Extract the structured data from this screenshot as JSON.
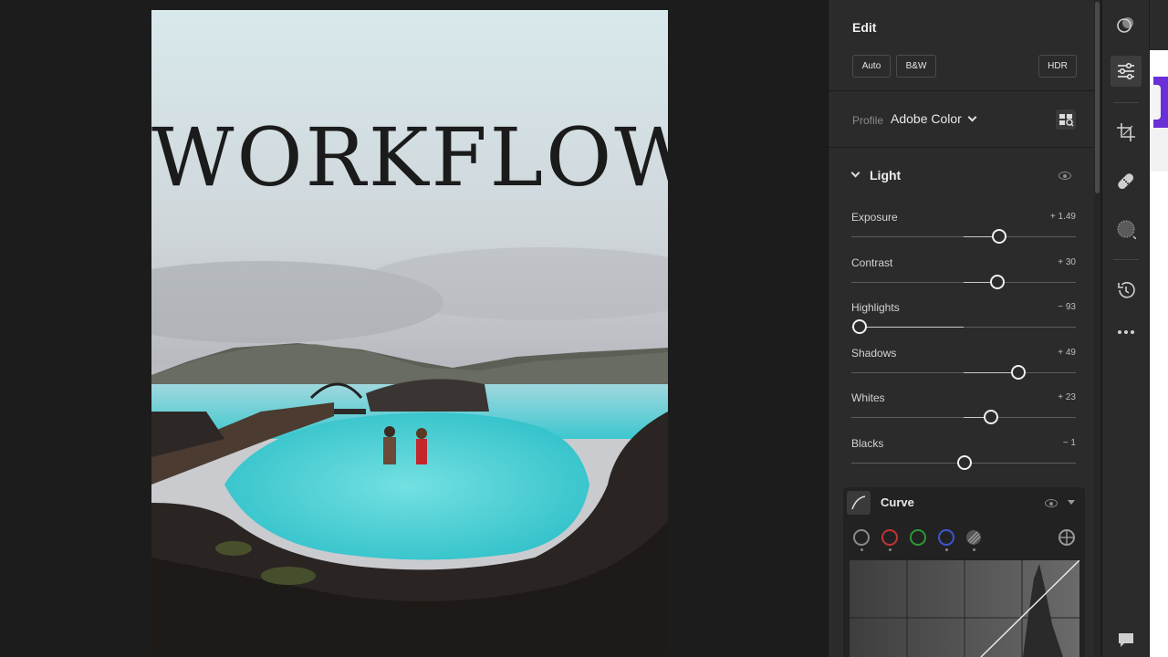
{
  "photo": {
    "overlay_text": "WORKFLOW"
  },
  "edit": {
    "title": "Edit",
    "buttons": {
      "auto": "Auto",
      "bw": "B&W",
      "hdr": "HDR"
    }
  },
  "profile": {
    "label": "Profile",
    "value": "Adobe Color",
    "browse_icon": "profile-browser-icon"
  },
  "light": {
    "title": "Light",
    "sliders": [
      {
        "label": "Exposure",
        "value": "+ 1.49",
        "pos": 0.66
      },
      {
        "label": "Contrast",
        "value": "+ 30",
        "pos": 0.65
      },
      {
        "label": "Highlights",
        "value": "− 93",
        "pos": 0.035
      },
      {
        "label": "Shadows",
        "value": "+ 49",
        "pos": 0.745
      },
      {
        "label": "Whites",
        "value": "+ 23",
        "pos": 0.62
      },
      {
        "label": "Blacks",
        "value": "− 1",
        "pos": 0.505
      }
    ]
  },
  "curve": {
    "title": "Curve",
    "channels": [
      "point-curve",
      "red",
      "green",
      "blue",
      "parametric"
    ],
    "channel_colors": [
      "#8a8a8a",
      "#d23b3b",
      "#2fa33a",
      "#3a5bd6",
      "#aaaaaa"
    ]
  },
  "tools": [
    "presets-icon",
    "edit-icon",
    "crop-icon",
    "healing-icon",
    "masking-icon",
    "history-icon",
    "more-icon",
    "comments-icon"
  ],
  "colors": {
    "panel": "#2b2b2b",
    "accent_purple": "#6b2fd8"
  }
}
